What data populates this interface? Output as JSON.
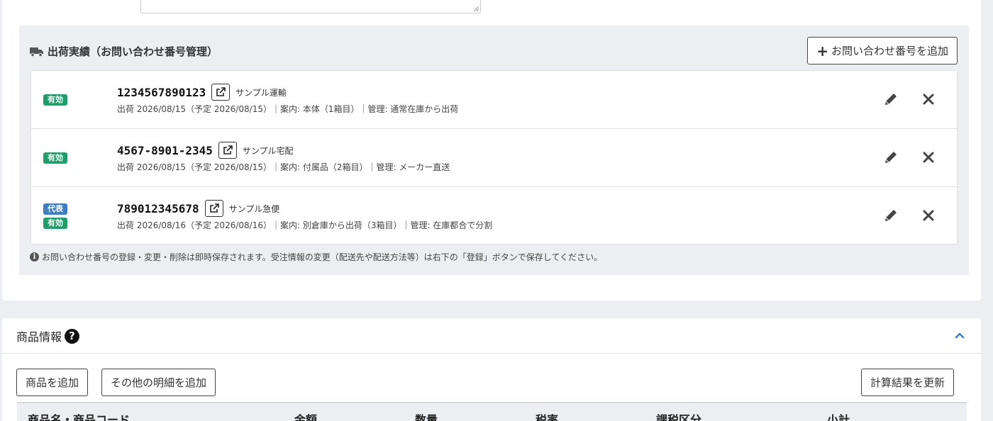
{
  "shipping": {
    "title": "出荷実績（お問い合わせ番号管理）",
    "add_button_label": "お問い合わせ番号を追加",
    "rows": [
      {
        "badges": [
          "有効"
        ],
        "tracking_no": "1234567890123",
        "carrier": "サンプル運輸",
        "detail": "出荷 2026/08/15（予定 2026/08/15）｜案内: 本体（1箱目）｜管理: 通常在庫から出荷"
      },
      {
        "badges": [
          "有効"
        ],
        "tracking_no": "4567-8901-2345",
        "carrier": "サンプル宅配",
        "detail": "出荷 2026/08/15（予定 2026/08/15）｜案内: 付属品（2箱目）｜管理: メーカー直送"
      },
      {
        "badges": [
          "代表",
          "有効"
        ],
        "tracking_no": "789012345678",
        "carrier": "サンプル急便",
        "detail": "出荷 2026/08/16（予定 2026/08/16）｜案内: 別倉庫から出荷（3箱目）｜管理: 在庫都合で分割"
      }
    ],
    "note": "お問い合わせ番号の登録・変更・削除は即時保存されます。受注情報の変更（配送先や配送方法等）は右下の「登録」ボタンで保存してください。"
  },
  "products": {
    "title": "商品情報",
    "add_product_label": "商品を追加",
    "add_other_label": "その他の明細を追加",
    "recalc_label": "計算結果を更新",
    "columns": [
      "商品名・商品コード",
      "金額",
      "数量",
      "税率",
      "課税区分",
      "小計"
    ]
  },
  "colors": {
    "valid_badge": "#1f9d6a",
    "rep_badge": "#3d7ec0",
    "chevron": "#3d7ec0"
  }
}
